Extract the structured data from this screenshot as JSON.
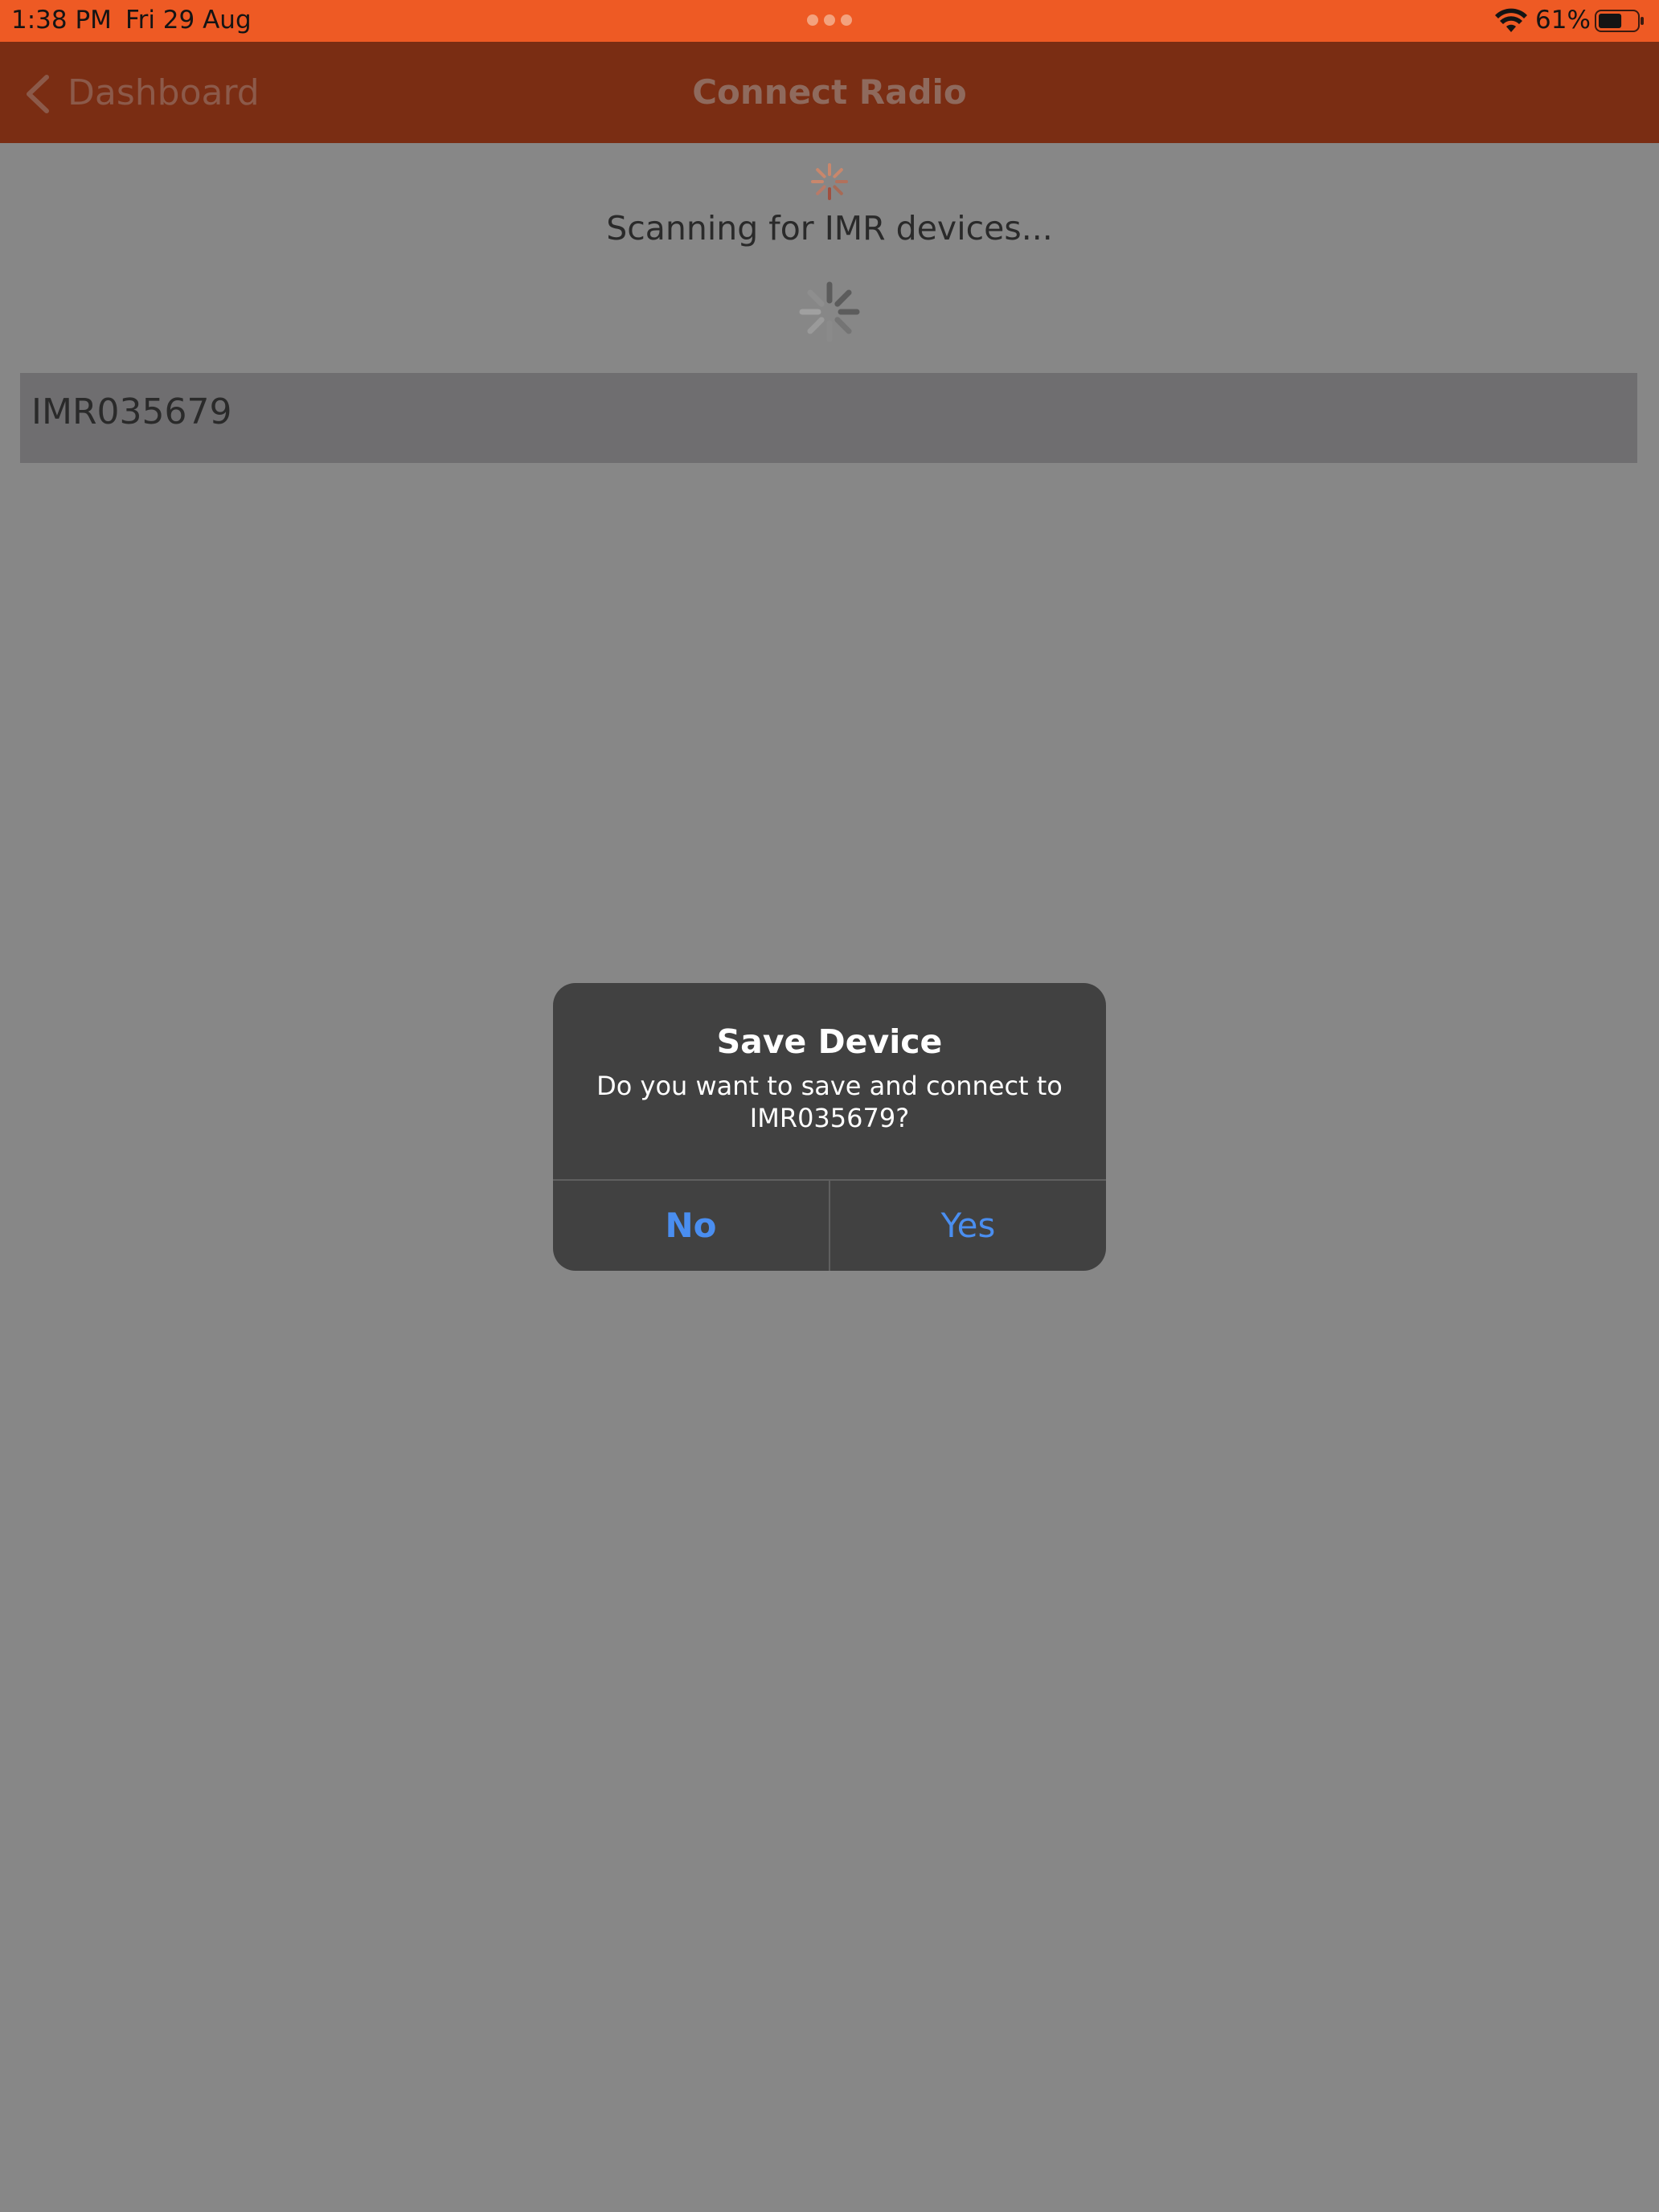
{
  "status_bar": {
    "time": "1:38 PM",
    "date": "Fri 29 Aug",
    "battery_percent": "61%",
    "battery_level": 0.61,
    "wifi_icon": "wifi-icon",
    "battery_icon": "battery-icon",
    "multitask_icon": "multitask-dots-icon"
  },
  "nav": {
    "back_label": "Dashboard",
    "back_icon": "chevron-left-icon",
    "title": "Connect Radio"
  },
  "scan": {
    "status_text": "Scanning for IMR devices...",
    "spinner_icon": "spinner-icon"
  },
  "devices": [
    {
      "name": "IMR035679"
    }
  ],
  "alert": {
    "title": "Save Device",
    "message": "Do you want to save and connect to IMR035679?",
    "no_label": "No",
    "yes_label": "Yes"
  },
  "colors": {
    "status_bar": "#ee5a24",
    "nav_bar": "#7a2d13",
    "dimmed_background": "#878787",
    "alert_background": "#414141",
    "alert_button_text": "#4a8ef0"
  }
}
